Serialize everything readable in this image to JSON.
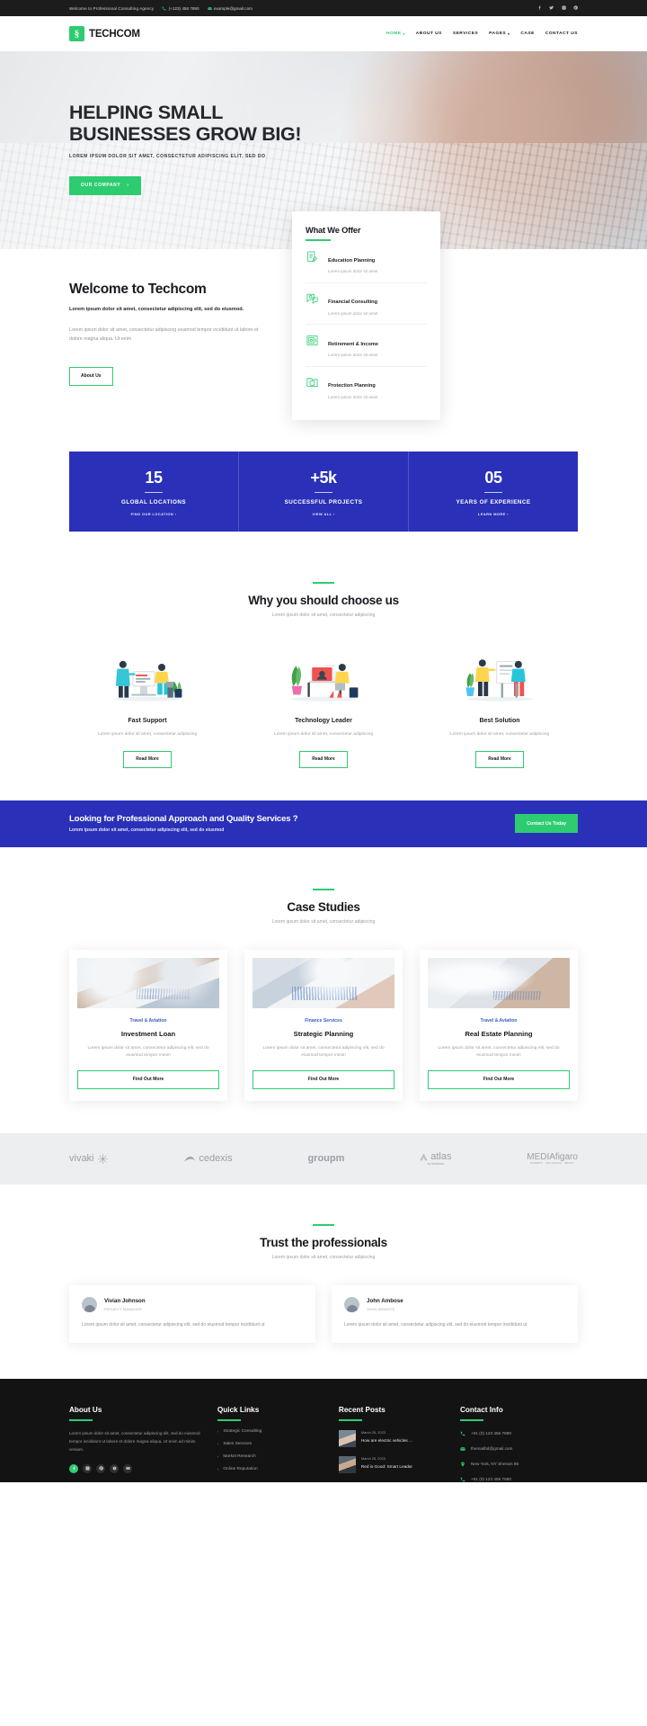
{
  "topbar": {
    "welcome": "Welcome to Professional Consulting Agency",
    "phone": "(+123) 456 7890",
    "email": "example@gmail.com",
    "socials": [
      "facebook-icon",
      "twitter-icon",
      "instagram-icon",
      "pinterest-icon"
    ]
  },
  "brand": {
    "name": "TECHCOM",
    "mark": "logo-mark-icon"
  },
  "nav": {
    "items": [
      {
        "label": "HOME",
        "active": true,
        "caret": "▾"
      },
      {
        "label": "ABOUT US",
        "active": false,
        "caret": ""
      },
      {
        "label": "SERVICES",
        "active": false,
        "caret": ""
      },
      {
        "label": "PAGES",
        "active": false,
        "caret": "▾"
      },
      {
        "label": "CASE",
        "active": false,
        "caret": ""
      },
      {
        "label": "CONTACT US",
        "active": false,
        "caret": ""
      }
    ]
  },
  "hero": {
    "title_line1": "HELPING SMALL",
    "title_line2": "BUSINESSES GROW BIG!",
    "subtitle": "LOREM IPSUM DOLOR SIT AMET, CONSECTETUR ADIPISCING ELIT, SED DO",
    "cta": "OUR COMPANY",
    "cta_arrow": "›"
  },
  "offer": {
    "heading": "What We Offer",
    "items": [
      {
        "icon": "document-pen-icon",
        "title": "Education Planning",
        "desc": "Lorem ipsum dolor sit amet"
      },
      {
        "icon": "chat-dollar-icon",
        "title": "Financial Consulting",
        "desc": "Lorem ipsum dolor sit amet"
      },
      {
        "icon": "safe-box-icon",
        "title": "Retirement & Income",
        "desc": "Lorem ipsum dolor sit amet"
      },
      {
        "icon": "shield-folder-icon",
        "title": "Protection Planning",
        "desc": "Lorem ipsum dolor sit amet"
      }
    ]
  },
  "welcome": {
    "title": "Welcome to Techcom",
    "lead": "Lorem ipsum dolor sit amet, consectetur adipiscing elit, sed do eiusmod.",
    "body": "Lorem ipsum dolor sit amet, consectetur adipiscing eiusmod tempor incididunt ut labore et dolore magna aliqua. Ut enim",
    "button": "About Us"
  },
  "chart_data": {
    "type": "bar",
    "title": "Company statistics",
    "categories": [
      "GLOBAL LOCATIONS",
      "SUCCESSFUL PROJECTS",
      "YEARS OF EXPERIENCE"
    ],
    "values": [
      15,
      5000,
      5
    ],
    "display_values": [
      "15",
      "+5k",
      "05"
    ],
    "links": [
      "FIND OUR LOCATION",
      "VIEW ALL",
      "LEARN MORE"
    ],
    "xlabel": "",
    "ylabel": "",
    "legend": "none",
    "grid": false
  },
  "stats": {
    "arrow": "›"
  },
  "choose": {
    "title": "Why you should choose us",
    "subtitle": "Lorem ipsum dolor sit amet, consectetur adipiscing",
    "cards": [
      {
        "title": "Fast Support",
        "desc": "Lorem ipsum dolor sit amet, consectetur adipiscing",
        "button": "Read More",
        "icon": "teamwork-desk-illustration"
      },
      {
        "title": "Technology Leader",
        "desc": "Lorem ipsum dolor sit amet, consectetur adipiscing",
        "button": "Read More",
        "icon": "video-call-desk-illustration"
      },
      {
        "title": "Best Solution",
        "desc": "Lorem ipsum dolor sit amet, consectetur adipiscing",
        "button": "Read More",
        "icon": "presentation-board-illustration"
      }
    ]
  },
  "cta": {
    "title": "Looking for Professional Approach and Quality Services ?",
    "subtitle": "Lorem ipsum dolor sit amet, consectetur adipiscing elit, sed do eiusmod",
    "button": "Contact Us Today"
  },
  "cases": {
    "title": "Case Studies",
    "subtitle": "Lorem ipsum dolor sit amet, consectetur adipiscing",
    "items": [
      {
        "category": "Travel & Aviation",
        "title": "Investment Loan",
        "desc": "Lorem ipsum dolor sit amet, consectetur adipiscing elit, sed do eiusmod tempor minim",
        "button": "Find Out More",
        "image": "meeting-documents-photo"
      },
      {
        "category": "Finance Services",
        "title": "Strategic Planning",
        "desc": "Lorem ipsum dolor sit amet, consectetur adipiscing elit, sed do eiusmod tempor minim",
        "button": "Find Out More",
        "image": "tablet-charts-photo"
      },
      {
        "category": "Travel & Aviation",
        "title": "Real Estate Planning",
        "desc": "Lorem ipsum dolor sit amet, consectetur adipiscing elit, sed do eiusmod tempor minim",
        "button": "Find Out More",
        "image": "hardhat-blueprint-photo"
      }
    ]
  },
  "brands": [
    {
      "name": "vivaki",
      "mark": "burst-icon"
    },
    {
      "name": "cedexis",
      "mark": "swoosh-icon"
    },
    {
      "name": "groupm",
      "mark": ""
    },
    {
      "name": "atlas",
      "sub": "by facebook",
      "mark": "a-icon"
    },
    {
      "name": "MEDIAfigaro",
      "sub": "EXPERTS · INFLUENCE · IMPACT",
      "mark": ""
    }
  ],
  "testimonials": {
    "title": "Trust the professionals",
    "subtitle": "Lorem ipsum dolor sit amet, consectetur adipiscing",
    "items": [
      {
        "name": "Vivian Johnson",
        "role": "PROJECT MANAGER",
        "text": "Lorem ipsum dolor sit amet, consectetur adipiscing elit, sed do eiusmod tempor incididunt ut"
      },
      {
        "name": "John Ambose",
        "role": "JOHN WEBSITE",
        "text": "Lorem ipsum dolor sit amet, consectetur adipiscing elit, sed do eiusmod tempor incididunt ut"
      }
    ]
  },
  "footer": {
    "about": {
      "heading": "About Us",
      "text": "Lorem ipsum dolor sit amet, consectetur adipiscing elit, sed do eiusmod tempor incididunt ut labore et dolore magna aliqua. Ut enim ad minim veniam.",
      "socials": [
        "facebook-icon",
        "instagram-icon",
        "pinterest-icon",
        "skype-icon",
        "youtube-icon"
      ]
    },
    "quick": {
      "heading": "Quick Links",
      "items": [
        "Strategic Consulting",
        "Sales Services",
        "Market Research",
        "Online Reputation"
      ],
      "chevron": "›"
    },
    "posts": {
      "heading": "Recent Posts",
      "items": [
        {
          "date": "March 25, 2023",
          "title": "How are electric vehicles ...",
          "image": "woman-portrait-thumb"
        },
        {
          "date": "March 25, 2023",
          "title": "Red is Good: Smart Leader",
          "image": "man-portrait-thumb"
        }
      ]
    },
    "contact": {
      "heading": "Contact Info",
      "items": [
        {
          "icon": "phone-icon",
          "text": "+91 (0) 123 456 7890"
        },
        {
          "icon": "mail-icon",
          "text": "themailbd@gmail.com"
        },
        {
          "icon": "pin-icon",
          "text": "New York, NY Sheram 85"
        },
        {
          "icon": "phone-icon",
          "text": "+91 (0) 123 456 7890"
        }
      ]
    }
  },
  "colors": {
    "green": "#2ecc71",
    "blue": "#2a30b8",
    "dark": "#131313",
    "muted": "#9aa0a6"
  }
}
